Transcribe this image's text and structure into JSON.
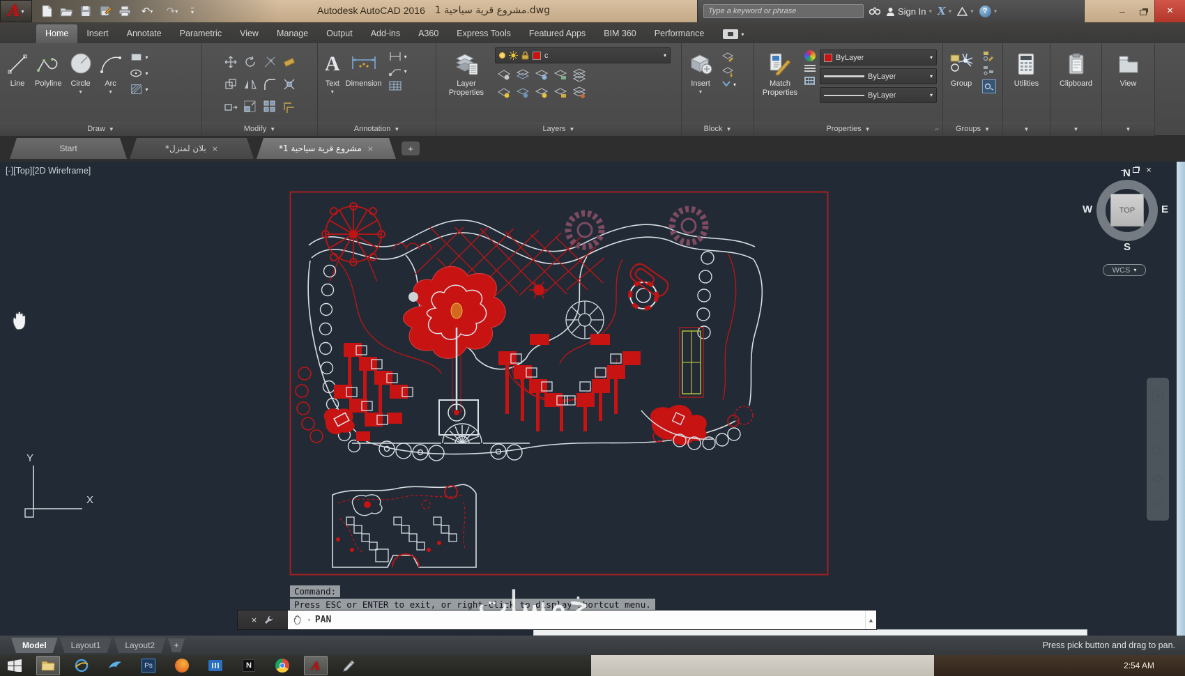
{
  "colors": {
    "accent_red": "#c01515",
    "canvas_bg": "#212a35",
    "titlebar_tan": "#cbb294",
    "close_red": "#c1463d",
    "ribbon_bg": "#4a4a4a",
    "white_line": "#dde2e6",
    "scrollbar_blue": "#b9d2e2"
  },
  "titlebar": {
    "app_title": "Autodesk AutoCAD 2016",
    "doc_title": "مشروع قرية سياحية 1.dwg",
    "search_placeholder": "Type a keyword or phrase",
    "sign_in_label": "Sign In",
    "quick_access_icons": [
      "acad-logo",
      "new-file",
      "open-file",
      "save",
      "save-as",
      "plot",
      "undo",
      "redo",
      "customize"
    ],
    "right_icons": [
      "search-binoculars",
      "sign-in-user",
      "exchange-x",
      "a360-triangle",
      "help",
      "minimize",
      "restore",
      "close"
    ]
  },
  "ribbon_tabs": [
    {
      "label": "Home"
    },
    {
      "label": "Insert"
    },
    {
      "label": "Annotate"
    },
    {
      "label": "Parametric"
    },
    {
      "label": "View"
    },
    {
      "label": "Manage"
    },
    {
      "label": "Output"
    },
    {
      "label": "Add-ins"
    },
    {
      "label": "A360"
    },
    {
      "label": "Express Tools"
    },
    {
      "label": "Featured Apps"
    },
    {
      "label": "BIM 360"
    },
    {
      "label": "Performance"
    }
  ],
  "panels": {
    "draw": {
      "title": "Draw",
      "line_label": "Line",
      "polyline_label": "Polyline",
      "circle_label": "Circle",
      "arc_label": "Arc",
      "small_tools": [
        "rectangle",
        "ellipse",
        "hatch"
      ]
    },
    "modify": {
      "title": "Modify",
      "tools": [
        "move",
        "rotate",
        "trim",
        "erase",
        "copy",
        "mirror",
        "fillet",
        "explode",
        "stretch",
        "scale",
        "array",
        "offset"
      ]
    },
    "annotation": {
      "title": "Annotation",
      "text_label": "Text",
      "dimension_label": "Dimension",
      "small_tools": [
        "linear-dimension",
        "multileader",
        "table"
      ]
    },
    "layers": {
      "title": "Layers",
      "props_label": "Layer Properties",
      "current_layer": "c",
      "combo_icons": [
        "layer-on-bulb",
        "layer-freeze-sun",
        "layer-lock",
        "layer-color-swatch"
      ],
      "small_tools": [
        "layer-off",
        "layer-isolate",
        "layer-freeze",
        "layer-lock-tool",
        "layer-match",
        "layer-on-all",
        "layer-unisolate",
        "layer-thaw",
        "layer-unlock",
        "layer-state"
      ]
    },
    "block": {
      "title": "Block",
      "insert_label": "Insert",
      "small_tools": [
        "edit-block",
        "create-block",
        "edit-attributes"
      ]
    },
    "properties": {
      "title": "Properties",
      "match_label": "Match Properties",
      "color_value": "ByLayer",
      "lineweight_value": "ByLayer",
      "linetype_value": "ByLayer",
      "small_tools": [
        "color-wheel",
        "lineweight-list",
        "transparency-grid"
      ]
    },
    "groups": {
      "title": "Groups",
      "group_label": "Group",
      "small_tools": [
        "ungroup",
        "group-edit",
        "group-selection-toggle"
      ]
    },
    "utilities": {
      "title": "Utilities"
    },
    "clipboard": {
      "title": "Clipboard"
    },
    "view": {
      "title": "View"
    }
  },
  "file_tabs": [
    {
      "label": "Start"
    },
    {
      "label": "*بلان لمنزل"
    },
    {
      "label": "*مشروع قرية سياحية 1"
    }
  ],
  "viewport": {
    "label": "[-][Top][2D Wireframe]",
    "viewcube": {
      "north": "N",
      "west": "W",
      "east": "E",
      "south": "S",
      "face": "TOP",
      "wcs_label": "WCS"
    },
    "nav_icons": [
      "navigation-wheel",
      "pan-hand",
      "zoom-magnifier",
      "orbit",
      "showmotion"
    ]
  },
  "command": {
    "history_line1": "Command:",
    "history_line2": "Press ESC or ENTER to exit, or right-click to display shortcut menu.",
    "active_command": "PAN"
  },
  "status": {
    "model_tab": "Model",
    "layout1_tab": "Layout1",
    "layout2_tab": "Layout2",
    "add_tab_icon": "+",
    "hint": "Press pick button and drag to pan."
  },
  "taskbar": {
    "time": "2:54 AM",
    "icons": [
      "windows-start",
      "file-explorer",
      "internet-explorer",
      "messenger",
      "photoshop",
      "firefox",
      "blue-app",
      "notepad-app",
      "chrome",
      "autocad",
      "sketch-app"
    ]
  },
  "watermark": {
    "text": "خمسات"
  }
}
